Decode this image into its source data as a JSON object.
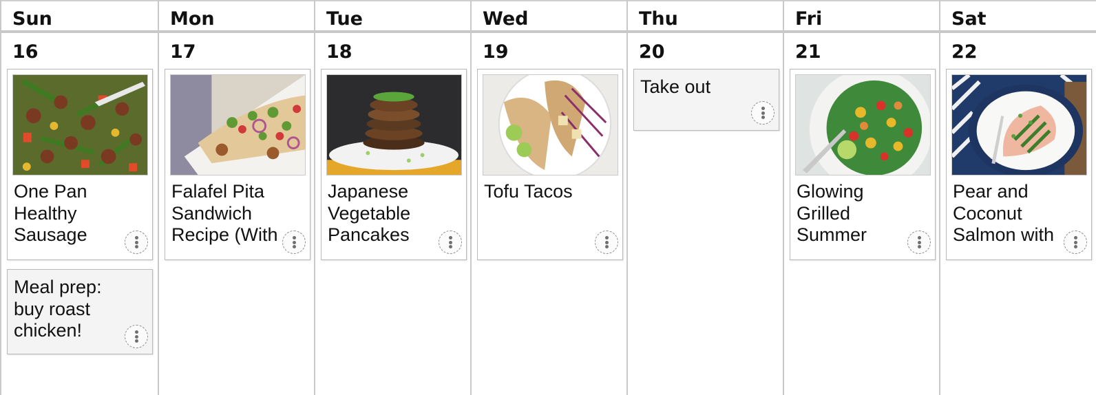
{
  "days": [
    {
      "name": "Sun",
      "number": "16"
    },
    {
      "name": "Mon",
      "number": "17"
    },
    {
      "name": "Tue",
      "number": "18"
    },
    {
      "name": "Wed",
      "number": "19"
    },
    {
      "name": "Thu",
      "number": "20"
    },
    {
      "name": "Fri",
      "number": "21"
    },
    {
      "name": "Sat",
      "number": "22"
    }
  ],
  "entries": {
    "sun_recipe": "One Pan Healthy Sausage and",
    "sun_note": "Meal prep: buy roast chicken!",
    "mon_recipe": "Falafel Pita Sandwich Recipe (With",
    "tue_recipe": "Japanese Vegetable Pancakes",
    "wed_recipe": "Tofu Tacos",
    "thu_note": "Take out",
    "fri_recipe": "Glowing Grilled Summer",
    "sat_recipe": "Pear and Coconut Salmon with"
  },
  "icons": {
    "entry_menu": "more-vertical-icon"
  },
  "colors": {
    "grid_line": "#c9c9c9",
    "note_background": "#f4f4f4",
    "card_border": "#b9b9b9"
  }
}
